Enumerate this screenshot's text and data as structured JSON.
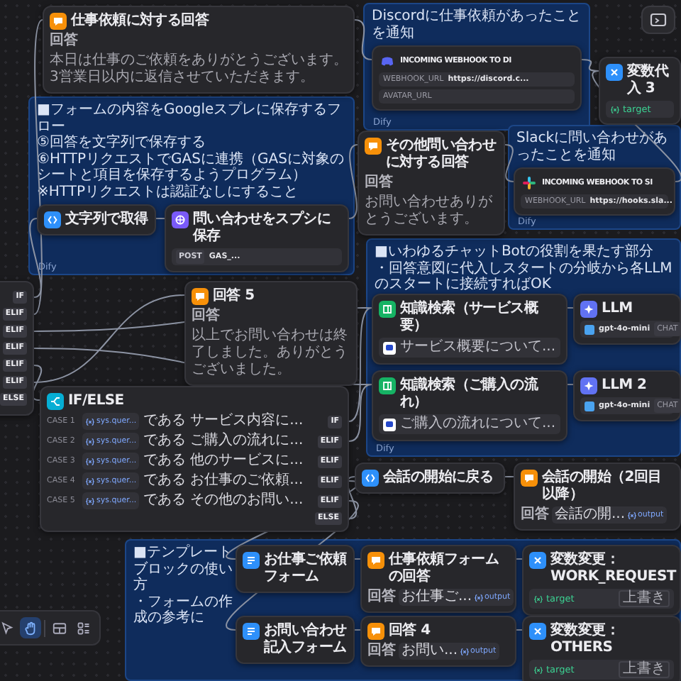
{
  "groups": [
    {
      "notes": [
        "■フォームの内容をGoogleスプレに保存するフロー",
        "⑤回答を文字列で保存する",
        "⑥HTTPリクエストでGASに連携（GASに対象のシートと項目を保存するようプログラム）",
        "※HTTPリクエストは認証なしにすること"
      ],
      "footer": "Dify"
    },
    {
      "notes": [
        "Discordに仕事依頼があったことを通知"
      ],
      "footer": "Dify"
    },
    {
      "notes": [
        "Slackに問い合わせがあったことを通知"
      ],
      "footer": "Dify"
    },
    {
      "notes": [
        "■いわゆるチャットBotの役割を果たす部分",
        "・回答意図に代入しスタートの分岐から各LLMのスタートに接続すればOK"
      ],
      "footer": "Dify"
    },
    {
      "notes": [
        "■テンプレートブロックの使い方",
        "・フォームの作成の参考に"
      ]
    }
  ],
  "nodes": [
    {
      "kind": "answer",
      "title": "仕事依頼に対する回答",
      "fields": [
        {
          "kind": "label",
          "text": "回答"
        },
        {
          "kind": "text",
          "text": "本日は仕事のご依頼をありがとうございます。3営業日以内に返信させていただきます。"
        }
      ]
    },
    {
      "kind": "discord",
      "title": "INCOMING WEBHOOK TO DI",
      "fields": [
        {
          "kind": "param",
          "key": "WEBHOOK_URL",
          "value": "https://discord.c..."
        },
        {
          "kind": "param",
          "key": "AVATAR_URL"
        }
      ]
    },
    {
      "kind": "assigner",
      "title": "変数代入 3",
      "fields": [
        {
          "kind": "target",
          "var": "target"
        }
      ]
    },
    {
      "kind": "code",
      "title": "文字列で取得"
    },
    {
      "kind": "http",
      "title": "問い合わせをスプシに保存",
      "fields": [
        {
          "kind": "method",
          "method": "POST",
          "url": "GAS_..."
        }
      ]
    },
    {
      "kind": "answer",
      "title": "その他問い合わせに対する回答",
      "fields": [
        {
          "kind": "label",
          "text": "回答"
        },
        {
          "kind": "text",
          "text": "お問い合わせありがとうございます。"
        }
      ]
    },
    {
      "kind": "slack",
      "title": "INCOMING WEBHOOK TO SI",
      "fields": [
        {
          "kind": "param",
          "key": "WEBHOOK_URL",
          "value": "https://hooks.sla..."
        }
      ]
    },
    {
      "kind": "ports",
      "ports": [
        "IF",
        "ELIF",
        "ELIF",
        "ELIF",
        "ELIF",
        "ELIF",
        "ELSE"
      ]
    },
    {
      "kind": "answer",
      "title": "回答 5",
      "fields": [
        {
          "kind": "label",
          "text": "回答"
        },
        {
          "kind": "text",
          "text": "以上でお問い合わせは終了しました。ありがとうございました。"
        }
      ]
    },
    {
      "kind": "knowledge",
      "title": "知識検索（サービス概要）",
      "fields": [
        {
          "kind": "doc",
          "text": "サービス概要について..."
        }
      ]
    },
    {
      "kind": "llm",
      "title": "LLM",
      "fields": [
        {
          "kind": "model",
          "model": "gpt-4o-mini",
          "mode": "CHAT"
        }
      ]
    },
    {
      "kind": "knowledge",
      "title": "知識検索（ご購入の流れ）",
      "fields": [
        {
          "kind": "doc",
          "text": "ご購入の流れについて..."
        }
      ]
    },
    {
      "kind": "llm",
      "title": "LLM 2",
      "fields": [
        {
          "kind": "model",
          "model": "gpt-4o-mini",
          "mode": "CHAT"
        }
      ]
    },
    {
      "kind": "ifelse",
      "title": "IF/ELSE",
      "cases": [
        {
          "label": "CASE 1",
          "port": "IF",
          "variable": "sys.quer...",
          "operator": "である",
          "value": "サービス内容に..."
        },
        {
          "label": "CASE 2",
          "port": "ELIF",
          "variable": "sys.quer...",
          "operator": "である",
          "value": "ご購入の流れに..."
        },
        {
          "label": "CASE 3",
          "port": "ELIF",
          "variable": "sys.quer...",
          "operator": "である",
          "value": "他のサービスに..."
        },
        {
          "label": "CASE 4",
          "port": "ELIF",
          "variable": "sys.quer...",
          "operator": "である",
          "value": "お仕事のご依頼..."
        },
        {
          "label": "CASE 5",
          "port": "ELIF",
          "variable": "sys.quer...",
          "operator": "である",
          "value": "その他のお問い..."
        }
      ],
      "else": "ELSE"
    },
    {
      "kind": "code",
      "title": "会話の開始に戻る"
    },
    {
      "kind": "answer",
      "title": "会話の開始（2回目以降）",
      "fields": [
        {
          "kind": "ref",
          "label": "回答",
          "node": "会話の開...",
          "var": "output"
        }
      ]
    },
    {
      "kind": "template",
      "title": "お仕事ご依頼フォーム"
    },
    {
      "kind": "answer",
      "title": "仕事依頼フォームの回答",
      "fields": [
        {
          "kind": "ref",
          "label": "回答",
          "node": "お仕事ご...",
          "var": "output"
        }
      ]
    },
    {
      "kind": "assigner",
      "title": "変数変更：WORK_REQUEST",
      "fields": [
        {
          "kind": "target",
          "var": "target",
          "op": "上書き"
        }
      ]
    },
    {
      "kind": "template",
      "title": "お問い合わせ記入フォーム"
    },
    {
      "kind": "answer",
      "title": "回答 4",
      "fields": [
        {
          "kind": "ref",
          "label": "回答",
          "node": "お問い...",
          "var": "output"
        }
      ]
    },
    {
      "kind": "assigner",
      "title": "変数変更：OTHERS",
      "fields": [
        {
          "kind": "target",
          "var": "target",
          "op": "上書き"
        }
      ]
    }
  ],
  "toolbar": {
    "tools": [
      {
        "kind": "pointer",
        "selected": false
      },
      {
        "kind": "hand",
        "selected": true
      },
      {
        "kind": "layout",
        "selected": false
      },
      {
        "kind": "grid",
        "selected": false
      }
    ]
  }
}
